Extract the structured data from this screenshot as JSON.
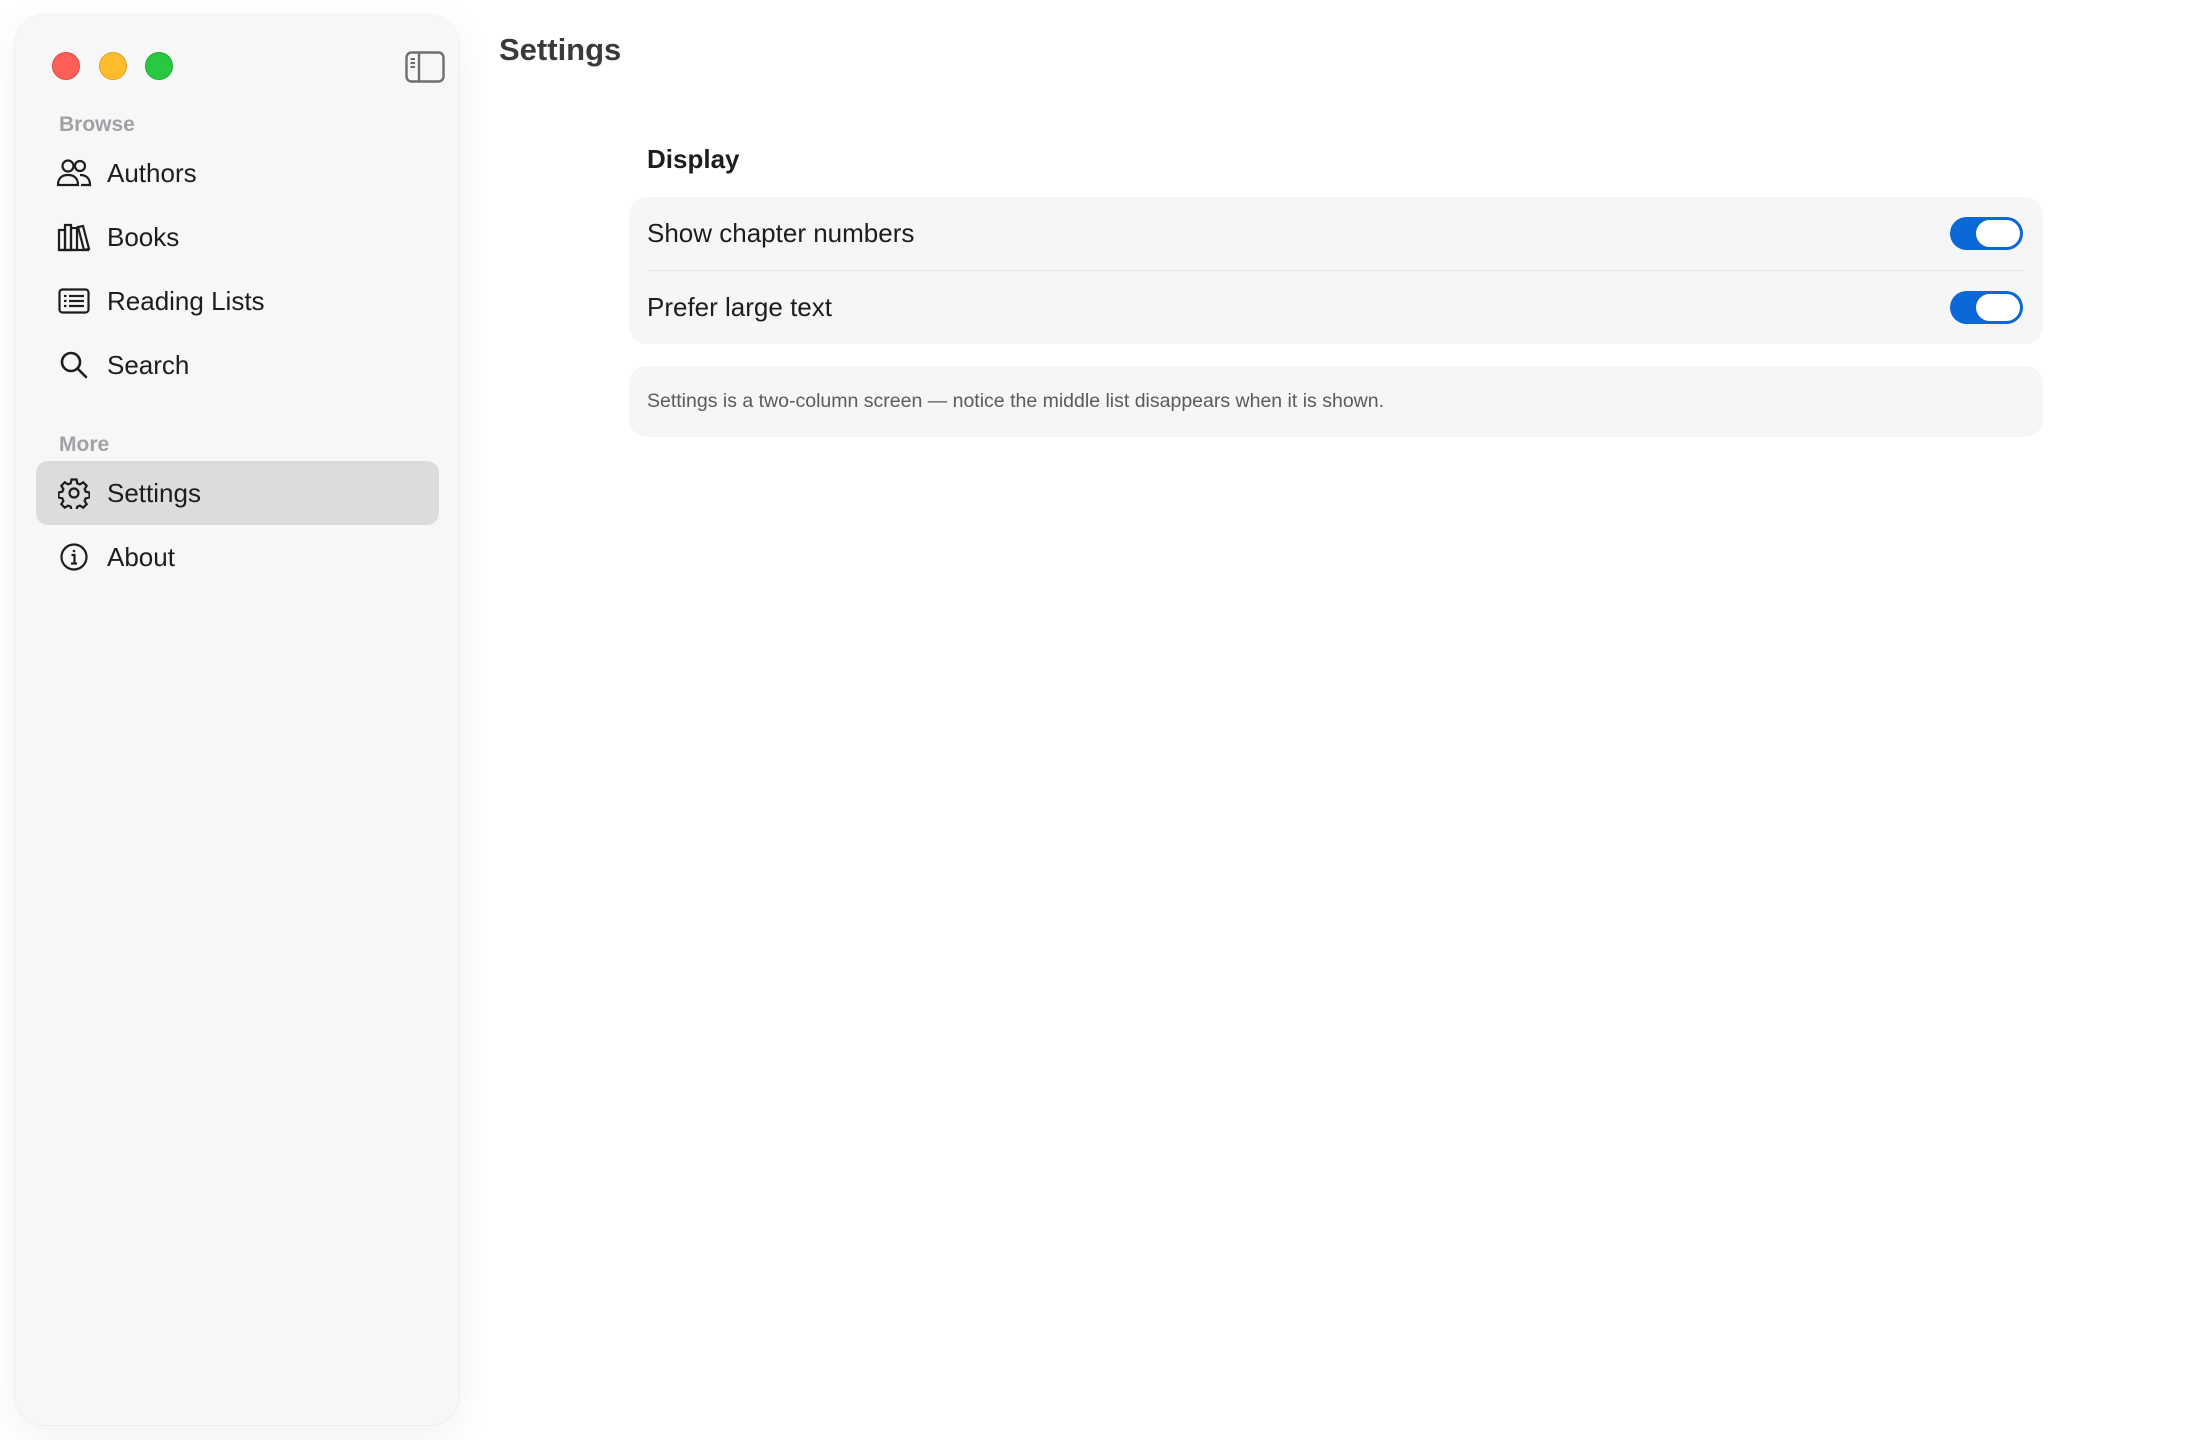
{
  "window": {
    "traffic_lights": [
      "close",
      "minimize",
      "zoom"
    ]
  },
  "sidebar": {
    "toggle_icon": "sidebar-toggle-icon",
    "sections": [
      {
        "label": "Browse",
        "items": [
          {
            "label": "Authors",
            "icon": "people-icon"
          },
          {
            "label": "Books",
            "icon": "books-icon"
          },
          {
            "label": "Reading Lists",
            "icon": "list-icon"
          },
          {
            "label": "Search",
            "icon": "search-icon"
          }
        ]
      },
      {
        "label": "More",
        "items": [
          {
            "label": "Settings",
            "icon": "gear-icon",
            "selected": true
          },
          {
            "label": "About",
            "icon": "info-icon"
          }
        ]
      }
    ]
  },
  "main": {
    "title": "Settings",
    "group_title": "Display",
    "rows": [
      {
        "label": "Show chapter numbers",
        "on": true
      },
      {
        "label": "Prefer large text",
        "on": true
      }
    ],
    "note": "Settings is a two-column screen — notice the middle list disappears when it is shown."
  },
  "colors": {
    "accent": "#0a68d8",
    "selection": "#dcdcdc",
    "sidebar_bg": "#f7f7f7"
  }
}
